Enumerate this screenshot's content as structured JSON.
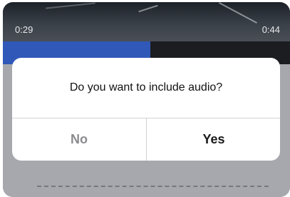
{
  "video": {
    "time_elapsed": "0:29",
    "time_total": "0:44"
  },
  "dialog": {
    "message": "Do you want to include audio?",
    "no_label": "No",
    "yes_label": "Yes"
  }
}
